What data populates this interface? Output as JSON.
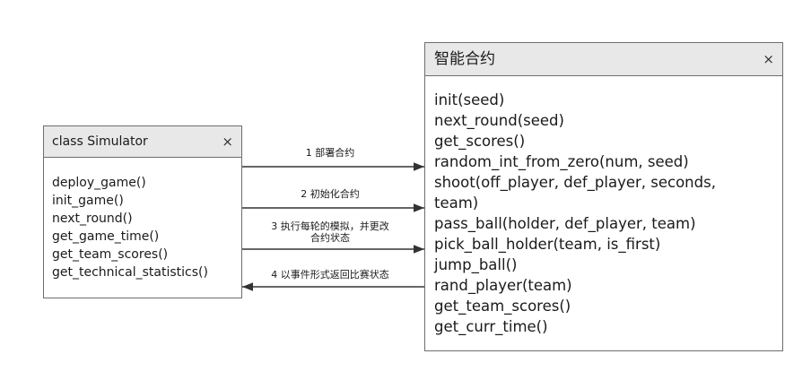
{
  "simulator": {
    "title": "class Simulator",
    "close_label": "×",
    "methods": [
      "deploy_game()",
      "init_game()",
      "next_round()",
      "get_game_time()",
      "get_team_scores()",
      "get_technical_statistics()"
    ]
  },
  "contract": {
    "title": "智能合约",
    "close_label": "×",
    "methods": [
      "init(seed)",
      "next_round(seed)",
      "get_scores()",
      "random_int_from_zero(num, seed)",
      "shoot(off_player, def_player, seconds,",
      "team)",
      "pass_ball(holder, def_player, team)",
      "pick_ball_holder(team, is_first)",
      "jump_ball()",
      "rand_player(team)",
      "get_team_scores()",
      "get_curr_time()"
    ]
  },
  "messages": [
    {
      "label": "1 部署合约",
      "direction": "to-contract"
    },
    {
      "label": "2 初始化合约",
      "direction": "to-contract"
    },
    {
      "label_line1": "3 执行每轮的模拟，并更改",
      "label_line2": "合约状态",
      "direction": "to-contract"
    },
    {
      "label": "4 以事件形式返回比赛状态",
      "direction": "to-simulator"
    }
  ]
}
